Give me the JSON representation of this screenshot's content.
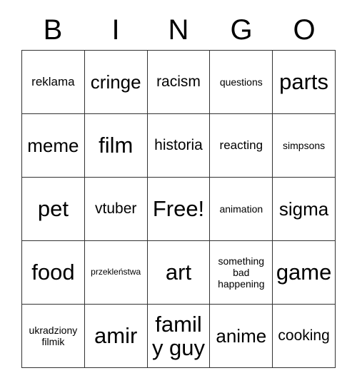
{
  "card": {
    "header_letters": [
      "B",
      "I",
      "N",
      "G",
      "O"
    ],
    "free_space_label": "Free!",
    "rows": [
      [
        {
          "text": "reklama",
          "size": "md"
        },
        {
          "text": "cringe",
          "size": "xl"
        },
        {
          "text": "racism",
          "size": "lg"
        },
        {
          "text": "questions",
          "size": "sm"
        },
        {
          "text": "parts",
          "size": "xxl"
        }
      ],
      [
        {
          "text": "meme",
          "size": "xl"
        },
        {
          "text": "film",
          "size": "xxl"
        },
        {
          "text": "historia",
          "size": "lg"
        },
        {
          "text": "reacting",
          "size": "md"
        },
        {
          "text": "simpsons",
          "size": "sm"
        }
      ],
      [
        {
          "text": "pet",
          "size": "xxl"
        },
        {
          "text": "vtuber",
          "size": "lg"
        },
        {
          "text": "Free!",
          "size": "xxl"
        },
        {
          "text": "animation",
          "size": "sm"
        },
        {
          "text": "sigma",
          "size": "xl"
        }
      ],
      [
        {
          "text": "food",
          "size": "xxl"
        },
        {
          "text": "przekleństwa",
          "size": "xs"
        },
        {
          "text": "art",
          "size": "xxl"
        },
        {
          "text": "something bad happening",
          "size": "sm"
        },
        {
          "text": "game",
          "size": "xxl"
        }
      ],
      [
        {
          "text": "ukradziony filmik",
          "size": "sm"
        },
        {
          "text": "amir",
          "size": "xxl"
        },
        {
          "text": "family guy",
          "size": "xxl"
        },
        {
          "text": "anime",
          "size": "xl"
        },
        {
          "text": "cooking",
          "size": "lg"
        }
      ]
    ]
  }
}
